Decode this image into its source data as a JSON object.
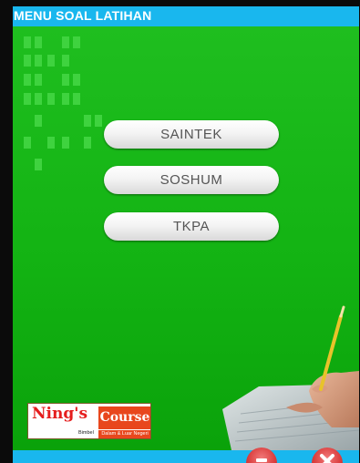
{
  "window": {
    "title": "MENU SOAL LATIHAN"
  },
  "menu": {
    "buttons": [
      {
        "label": "SAINTEK"
      },
      {
        "label": "SOSHUM"
      },
      {
        "label": "TKPA"
      }
    ]
  },
  "logo": {
    "name_part1": "Ning's",
    "name_part2": "Course",
    "tagline_left": "Bimbel",
    "tagline_right": "Dalam & Luar Negeri"
  },
  "bottom_controls": {
    "left_button_icon": "minimize-icon",
    "right_button_icon": "close-icon"
  },
  "colors": {
    "panel_green": "#13b313",
    "window_blue": "#19b7ee",
    "pattern_green": "#3fd33f",
    "control_red": "#d93b3b"
  }
}
